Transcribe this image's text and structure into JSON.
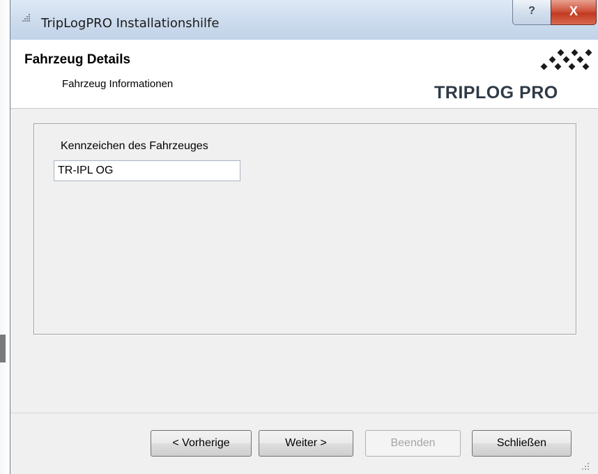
{
  "window": {
    "title": "TripLogPRO Installationshilfe",
    "help_glyph": "?",
    "close_glyph": "X"
  },
  "header": {
    "title": "Fahrzeug Details",
    "subtitle": "Fahrzeug Informationen",
    "logo_text": "TRIPLOG PRO"
  },
  "form": {
    "plate_label": "Kennzeichen des Fahrzeuges",
    "plate_value": "TR-IPL OG"
  },
  "buttons": {
    "previous": "< Vorherige",
    "next": "Weiter >",
    "finish": "Beenden",
    "close": "Schließen"
  },
  "colors": {
    "close_button": "#c23a22",
    "titlebar": "#cddcee",
    "disabled_text": "#a5a5a5"
  }
}
